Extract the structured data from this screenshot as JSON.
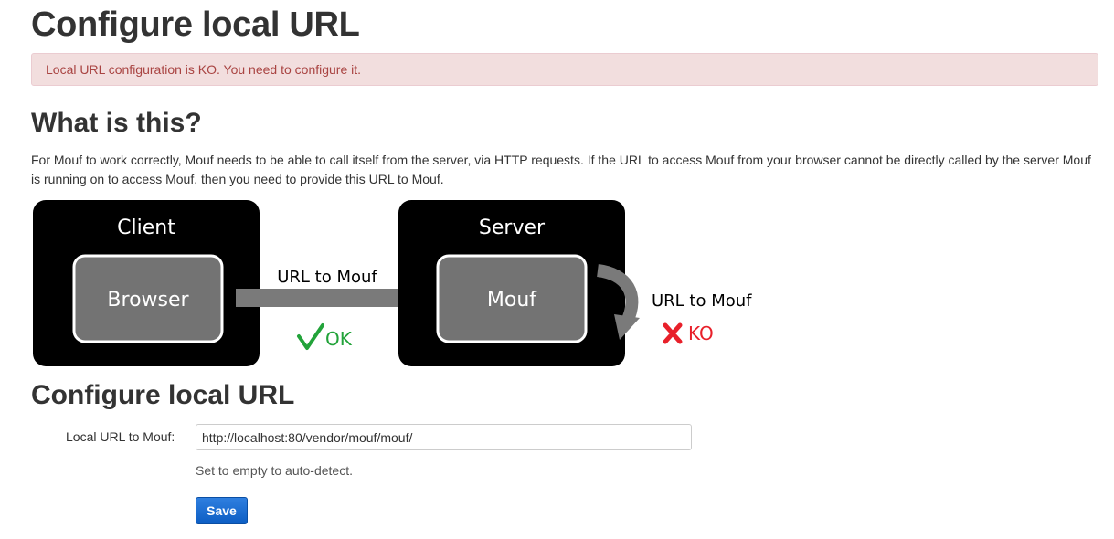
{
  "page": {
    "title": "Configure local URL"
  },
  "alert": {
    "message": "Local URL configuration is KO. You need to configure it.",
    "color": "#a94442",
    "background": "#f2dede"
  },
  "about": {
    "title": "What is this?",
    "description": "For Mouf to work correctly, Mouf needs to be able to call itself from the server, via HTTP requests. If the URL to access Mouf from your browser cannot be directly called by the server Mouf is running on to access Mouf, then you need to provide this URL to Mouf."
  },
  "diagram": {
    "client_label": "Client",
    "browser_label": "Browser",
    "arrow_label": "URL to Mouf",
    "ok_label": "OK",
    "ok_icon": "check-icon",
    "ok_color": "#22a33a",
    "server_label": "Server",
    "mouf_label": "Mouf",
    "loop_label": "URL to Mouf",
    "ko_label": "KO",
    "ko_icon": "cross-icon",
    "ko_color": "#e8202a"
  },
  "config": {
    "title": "Configure local URL",
    "field_label": "Local URL to Mouf:",
    "field_value": "http://localhost:80/vendor/mouf/mouf/",
    "help_text": "Set to empty to auto-detect.",
    "save_label": "Save"
  }
}
